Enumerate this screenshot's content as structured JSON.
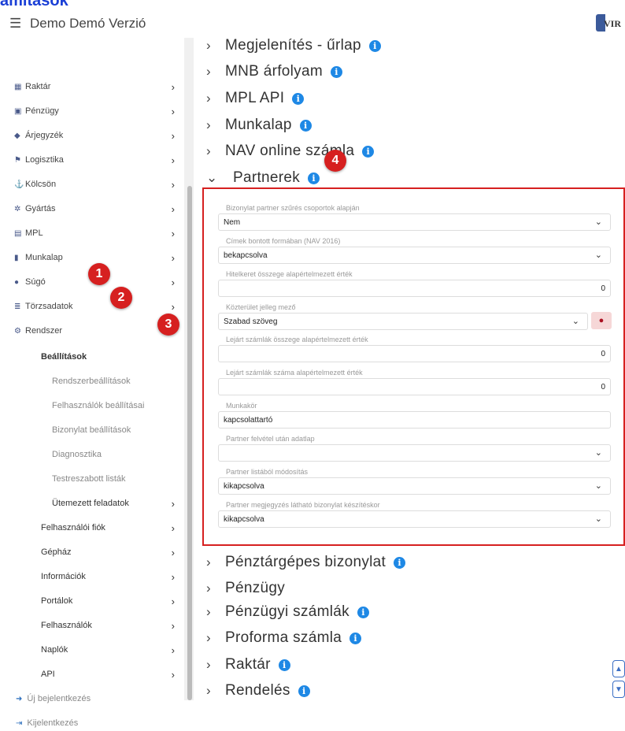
{
  "top_title": "ámítások",
  "header": {
    "menu_icon": "hamburger-icon",
    "app_title": "Demo Demó Verzió",
    "logo_text": "VIR"
  },
  "sidebar": {
    "items": [
      {
        "label": "Raktár",
        "icon": "warehouse-icon"
      },
      {
        "label": "Pénzügy",
        "icon": "money-icon"
      },
      {
        "label": "Árjegyzék",
        "icon": "tag-icon"
      },
      {
        "label": "Logisztika",
        "icon": "truck-icon"
      },
      {
        "label": "Kölcsön",
        "icon": "anchor-icon"
      },
      {
        "label": "Gyártás",
        "icon": "gears-icon"
      },
      {
        "label": "MPL",
        "icon": "mpl-icon"
      },
      {
        "label": "Munkalap",
        "icon": "file-icon"
      },
      {
        "label": "Súgó",
        "icon": "question-icon"
      },
      {
        "label": "Törzsadatok",
        "icon": "database-icon"
      },
      {
        "label": "Rendszer",
        "icon": "cogs-icon"
      }
    ],
    "settings_label": "Beállítások",
    "settings_children": [
      "Rendszerbeállítások",
      "Felhasználók beállításai",
      "Bizonylat beállítások",
      "Diagnosztika",
      "Testreszabott listák"
    ],
    "scheduled_tasks": "Ütemezett feladatok",
    "system_children": [
      "Felhasználói fiók",
      "Gépház",
      "Információk",
      "Portálok",
      "Felhasználók",
      "Naplók",
      "API"
    ],
    "new_login": "Új bejelentkezés",
    "logout": "Kijelentkezés"
  },
  "badges": [
    "1",
    "2",
    "3",
    "4"
  ],
  "sections_top": [
    "Megjelenítés - űrlap",
    "MNB árfolyam",
    "MPL API",
    "Munkalap",
    "NAV online számla"
  ],
  "section_open": "Partnerek",
  "sections_bottom": [
    "Pénztárgépes bizonylat",
    "Pénzügy",
    "Pénzügyi számlák",
    "Proforma számla",
    "Raktár",
    "Rendelés"
  ],
  "fields": [
    {
      "label": "Bizonylat partner szűrés csoportok alapján",
      "value": "Nem"
    },
    {
      "label": "Címek bontott formában (NAV 2016)",
      "value": "bekapcsolva"
    },
    {
      "label": "Hitelkeret összege alapértelmezett érték",
      "value": "0"
    },
    {
      "label": "Közterület jelleg mező",
      "value": "Szabad szöveg"
    },
    {
      "label": "Lejárt számlák összege alapértelmezett érték",
      "value": "0"
    },
    {
      "label": "Lejárt számlák száma alapértelmezett érték",
      "value": "0"
    },
    {
      "label": "Munkakör",
      "value": "kapcsolattartó"
    },
    {
      "label": "Partner felvétel után adatlap",
      "value": ""
    },
    {
      "label": "Partner listából módosítás",
      "value": "kikapcsolva"
    },
    {
      "label": "Partner megjegyzés látható bizonylat készítéskor",
      "value": "kikapcsolva"
    }
  ],
  "colors": {
    "accent": "#d62020",
    "info": "#1e88e5",
    "title": "#1a3fd6"
  }
}
